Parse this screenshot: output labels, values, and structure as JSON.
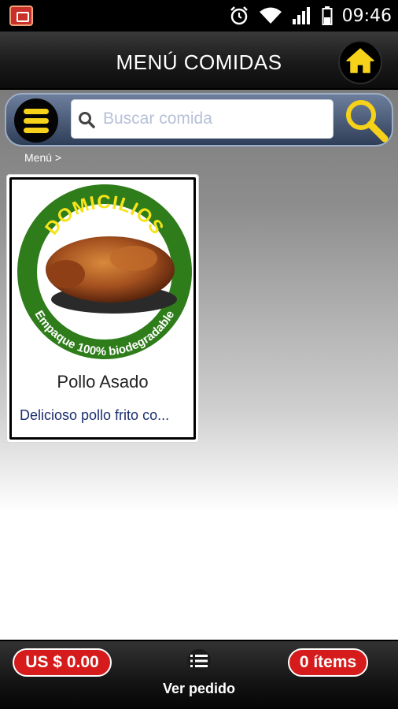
{
  "status_bar": {
    "time": "09:46",
    "icons": [
      "app-notification-icon",
      "alarm-clock-icon",
      "wifi-icon",
      "signal-icon",
      "battery-icon"
    ]
  },
  "header": {
    "title": "MENÚ COMIDAS",
    "home_icon": "home-icon"
  },
  "search": {
    "placeholder": "Buscar comida",
    "value": "",
    "menu_icon": "hamburger-menu-icon",
    "search_icon": "magnifier-icon"
  },
  "breadcrumb": "Menú >",
  "products": [
    {
      "name": "Pollo Asado",
      "description": "Delicioso pollo frito co...",
      "image_texts": {
        "top": "DOMICILIOS",
        "bottom": "Empaque 100% biodegradable"
      }
    }
  ],
  "footer": {
    "total": "US $ 0.00",
    "view_order_label": "Ver pedido",
    "items_count": "0 ítems"
  },
  "colors": {
    "accent_yellow": "#f6d21a",
    "badge_red": "#d51b1b",
    "seal_green": "#2e7d1a",
    "search_bar_blue": "#4a5a78",
    "description_blue": "#1a2f6e"
  }
}
